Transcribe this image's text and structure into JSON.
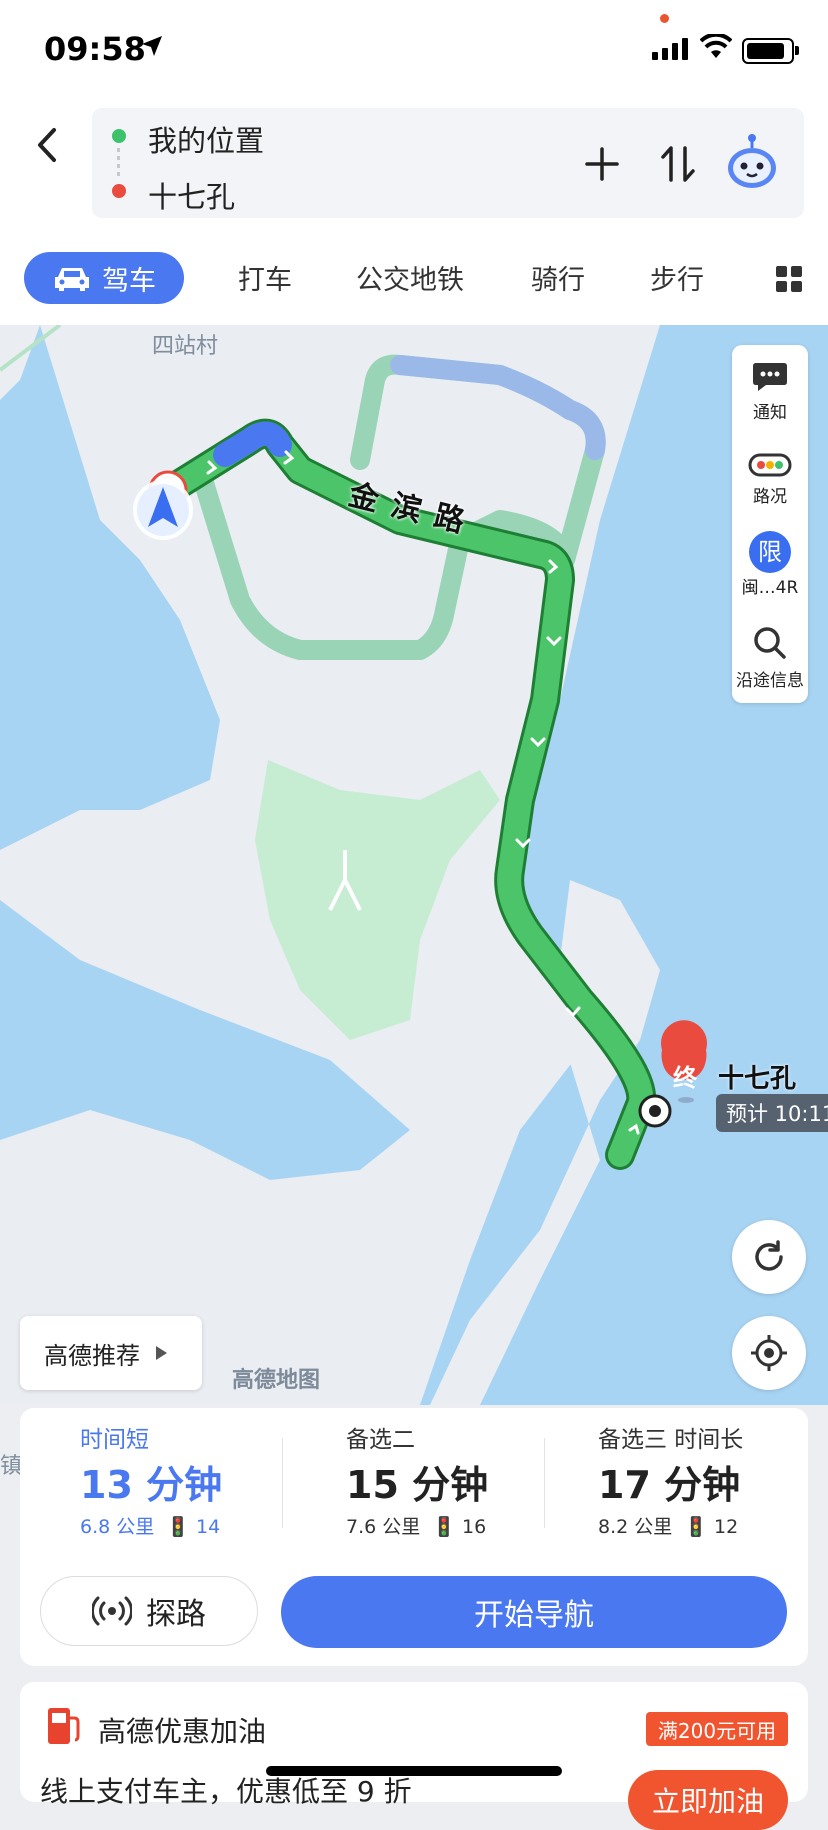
{
  "status_bar": {
    "time": "09:58"
  },
  "route_header": {
    "origin": "我的位置",
    "destination": "十七孔",
    "add_icon": "plus-icon",
    "swap_icon": "swap-icon",
    "assistant_icon": "assistant-robot-icon"
  },
  "tabs": {
    "active": "驾车",
    "items": [
      "打车",
      "公交地铁",
      "骑行",
      "步行"
    ]
  },
  "map": {
    "place_label": "四站村",
    "road_label": "金滨路",
    "watermark": "高德地图",
    "left_edge_label": "镇",
    "end_marker": "终",
    "end_name": "十七孔",
    "eta": "预计 10:11",
    "recommend_label": "高德推荐",
    "side_panel": [
      {
        "icon": "chat-icon",
        "label": "通知"
      },
      {
        "icon": "traffic-light-icon",
        "label": "路况"
      },
      {
        "icon": "restriction-icon",
        "label": "闽…4R",
        "badge": "限"
      },
      {
        "icon": "search-icon",
        "label": "沿途信息"
      }
    ],
    "colors": {
      "water": "#a8d4f4",
      "land": "#eaedf2",
      "park": "#c6ecd2",
      "route": "#4cc56a",
      "route_alt": "#8ccfac"
    }
  },
  "routes": [
    {
      "tag": "时间短",
      "time": "13 分钟",
      "distance": "6.8 公里",
      "lights": "14"
    },
    {
      "tag": "备选二",
      "time": "15 分钟",
      "distance": "7.6 公里",
      "lights": "16"
    },
    {
      "tag": "备选三  时间长",
      "time": "17 分钟",
      "distance": "8.2 公里",
      "lights": "12"
    }
  ],
  "actions": {
    "explore": "探路",
    "start_nav": "开始导航"
  },
  "fuel": {
    "title": "高德优惠加油",
    "badge": "满200元可用",
    "subtitle": "线上支付车主，优惠低至 9 折",
    "button": "立即加油"
  },
  "accent": "#4a78f0"
}
